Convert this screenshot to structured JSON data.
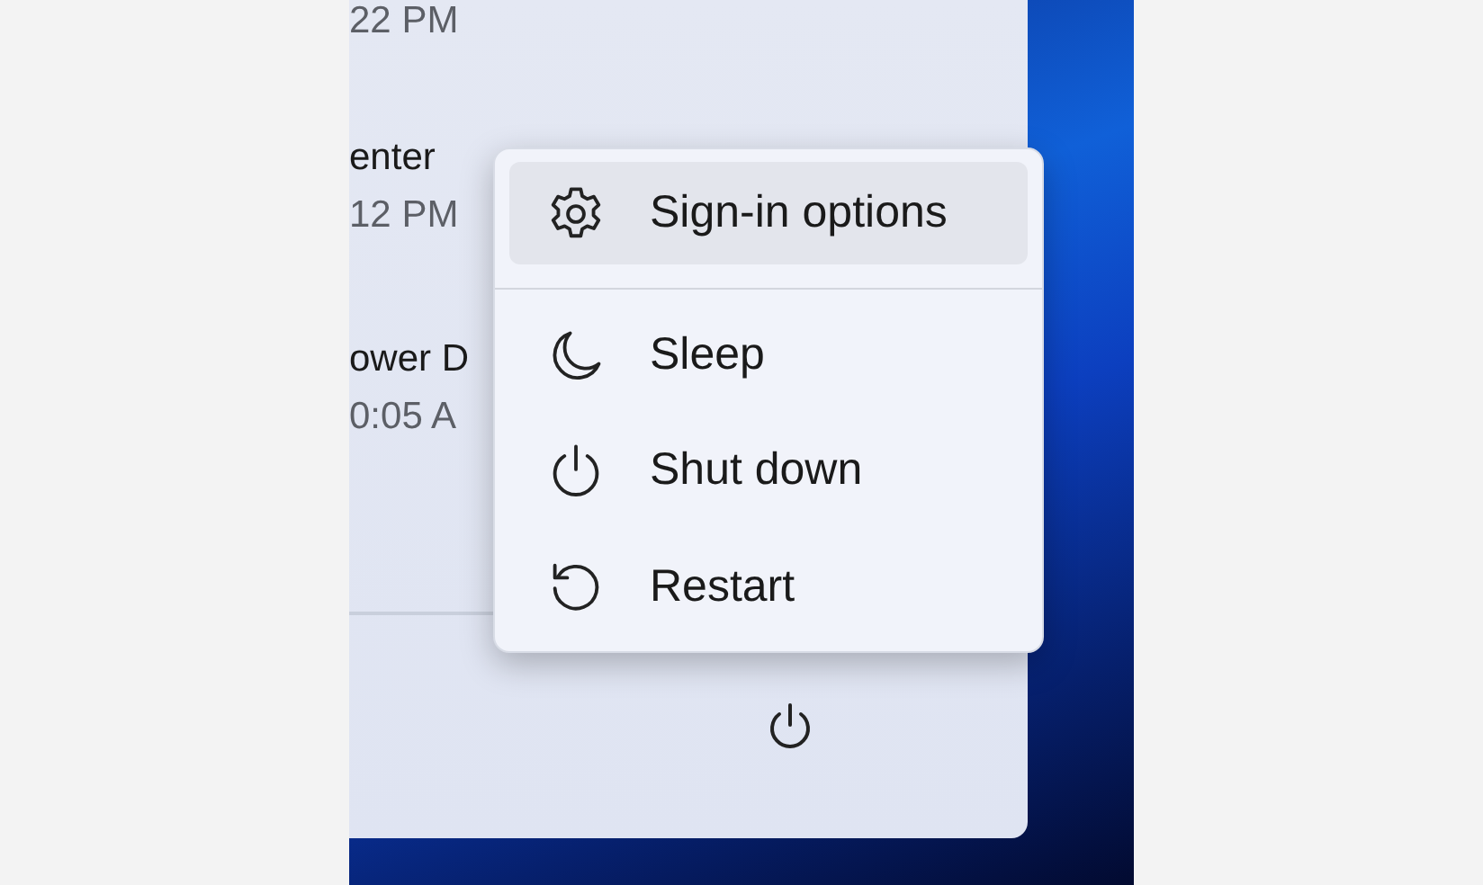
{
  "start_menu": {
    "recent_items": [
      {
        "time": "22 PM"
      },
      {
        "name": "enter",
        "time": "12 PM"
      },
      {
        "name": "ower D",
        "time": "0:05 A"
      }
    ]
  },
  "power_menu": {
    "items": [
      {
        "kind": "settings",
        "label": "Sign-in options",
        "selected": true
      },
      {
        "kind": "sleep",
        "label": "Sleep",
        "selected": false
      },
      {
        "kind": "power",
        "label": "Shut down",
        "selected": false
      },
      {
        "kind": "restart",
        "label": "Restart",
        "selected": false
      }
    ]
  }
}
